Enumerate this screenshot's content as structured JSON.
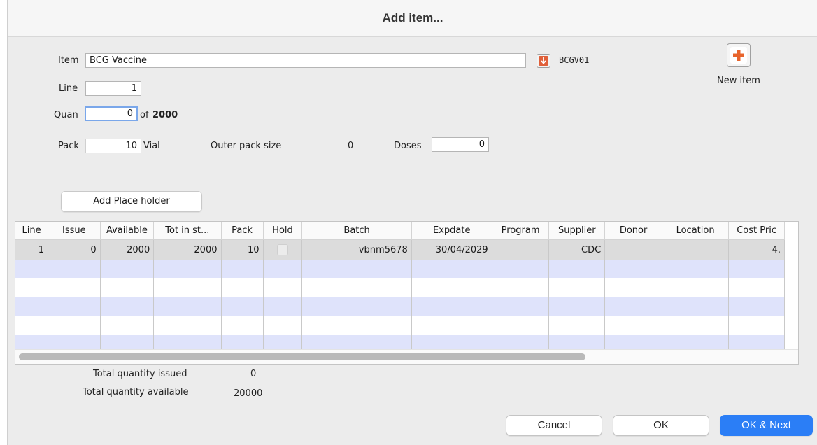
{
  "window": {
    "title": "Add item..."
  },
  "form": {
    "item_label": "Item",
    "item_value": "BCG Vaccine",
    "item_code": "BCGV01",
    "line_label": "Line",
    "line_value": "1",
    "quan_label": "Quan",
    "quan_value": "0",
    "of_label": "of",
    "of_value": "2000",
    "pack_label": "Pack",
    "pack_value": "10",
    "pack_unit": "Vial",
    "outer_pack_label": "Outer pack size",
    "outer_pack_value": "0",
    "doses_label": "Doses",
    "doses_value": "0"
  },
  "new_item": {
    "label": "New item",
    "icon": "plus-icon",
    "color": "#e8642c"
  },
  "placeholder_button": "Add Place holder",
  "table": {
    "columns": [
      "Line",
      "Issue",
      "Available",
      "Tot in st...",
      "Pack",
      "Hold",
      "Batch",
      "Expdate",
      "Program",
      "Supplier",
      "Donor",
      "Location",
      "Cost Pric"
    ],
    "rows": [
      {
        "line": "1",
        "issue": "0",
        "available": "2000",
        "tot_in_stock": "2000",
        "pack": "10",
        "hold": false,
        "batch": "vbnm5678",
        "expdate": "30/04/2029",
        "program": "",
        "supplier": "CDC",
        "donor": "",
        "location": "",
        "cost_price": "4."
      }
    ]
  },
  "totals": {
    "issued_label": "Total quantity issued",
    "issued_value": "0",
    "available_label": "Total quantity available",
    "available_value": "20000"
  },
  "buttons": {
    "cancel": "Cancel",
    "ok": "OK",
    "ok_next": "OK & Next"
  },
  "colors": {
    "accent": "#2b7ef6",
    "row_stripe": "#dfe3fb",
    "selected_row": "#dcdcdc"
  }
}
